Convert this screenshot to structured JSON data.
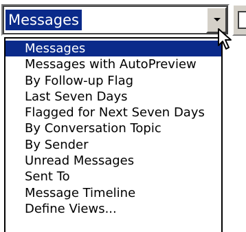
{
  "combo": {
    "value": "Messages"
  },
  "list": {
    "items": [
      {
        "label": "Messages",
        "selected": true
      },
      {
        "label": "Messages with AutoPreview",
        "selected": false
      },
      {
        "label": "By Follow-up Flag",
        "selected": false
      },
      {
        "label": "Last Seven Days",
        "selected": false
      },
      {
        "label": "Flagged for Next Seven Days",
        "selected": false
      },
      {
        "label": "By Conversation Topic",
        "selected": false
      },
      {
        "label": "By Sender",
        "selected": false
      },
      {
        "label": "Unread Messages",
        "selected": false
      },
      {
        "label": "Sent To",
        "selected": false
      },
      {
        "label": "Message Timeline",
        "selected": false
      },
      {
        "label": "Define Views...",
        "selected": false
      }
    ]
  },
  "icons": {
    "dropdown": "chevron-down-icon",
    "cursor": "mouse-pointer-icon"
  },
  "colors": {
    "selection": "#0a2a8a",
    "face": "#d4d0c8"
  }
}
